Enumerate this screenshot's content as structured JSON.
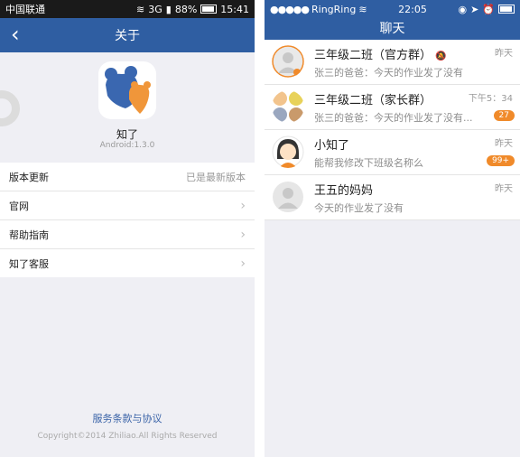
{
  "left": {
    "status": {
      "carrier": "中国联通",
      "network": "3G",
      "battery": "88%",
      "time": "15:41"
    },
    "nav": {
      "title": "关于"
    },
    "app": {
      "name": "知了",
      "version": "Android:1.3.0"
    },
    "menu": [
      {
        "label": "版本更新",
        "value": "已是最新版本"
      },
      {
        "label": "官网",
        "value": ""
      },
      {
        "label": "帮助指南",
        "value": ""
      },
      {
        "label": "知了客服",
        "value": ""
      }
    ],
    "terms": "服务条款与协议",
    "copyright": "Copyright©2014 Zhiliao.All Rights Reserved"
  },
  "right": {
    "status": {
      "carrier": "RingRing",
      "time": "22:05"
    },
    "nav": {
      "title": "聊天"
    },
    "chats": [
      {
        "name": "三年级二班（官方群）",
        "message": "张三的爸爸：今天的作业发了没有",
        "time": "昨天",
        "badge": ""
      },
      {
        "name": "三年级二班（家长群）",
        "message": "张三的爸爸：今天的作业发了没有...",
        "time": "下午5：34",
        "badge": "27"
      },
      {
        "name": "小知了",
        "message": "能帮我修改下班级名称么",
        "time": "昨天",
        "badge": "99+"
      },
      {
        "name": "王五的妈妈",
        "message": "今天的作业发了没有",
        "time": "昨天",
        "badge": ""
      }
    ]
  },
  "colors": {
    "brand": "#2f5ea2",
    "badge": "#f08a2a",
    "logo_blue": "#3a67b0",
    "logo_orange": "#f0963a"
  }
}
